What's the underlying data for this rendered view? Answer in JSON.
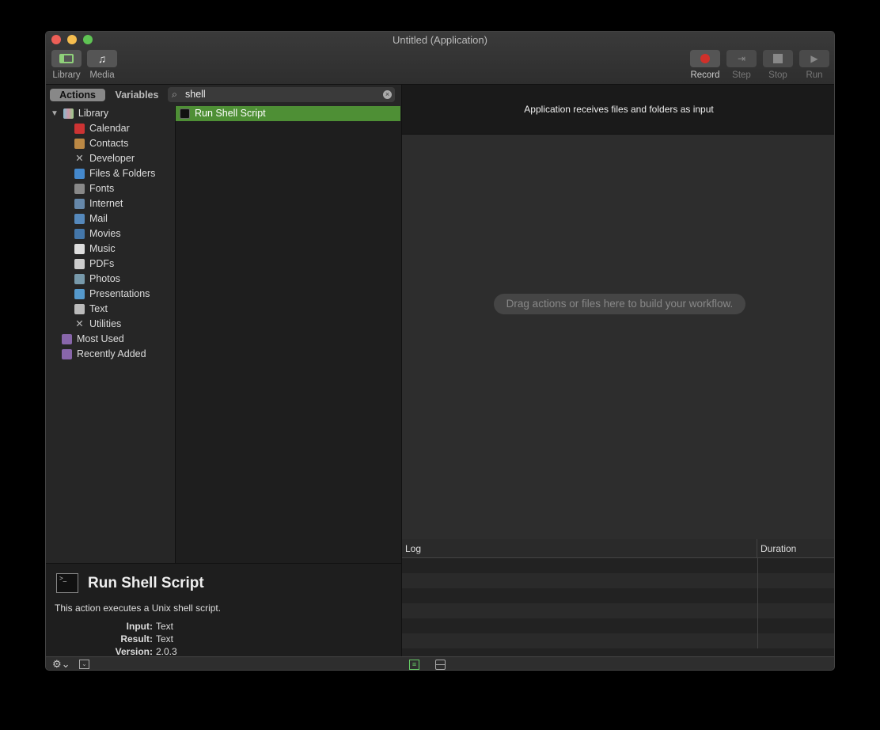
{
  "window": {
    "title": "Untitled (Application)"
  },
  "toolbar": {
    "library": "Library",
    "media": "Media",
    "record": "Record",
    "step": "Step",
    "stop": "Stop",
    "run": "Run",
    "record_color": "#d0302a"
  },
  "tabs": {
    "actions": "Actions",
    "variables": "Variables"
  },
  "search": {
    "value": "shell"
  },
  "sidebar": {
    "root": "Library",
    "items": [
      "Calendar",
      "Contacts",
      "Developer",
      "Files & Folders",
      "Fonts",
      "Internet",
      "Mail",
      "Movies",
      "Music",
      "PDFs",
      "Photos",
      "Presentations",
      "Text",
      "Utilities"
    ],
    "extras": [
      "Most Used",
      "Recently Added"
    ]
  },
  "results": [
    {
      "label": "Run Shell Script",
      "selected_color": "#4e8f35"
    }
  ],
  "description": {
    "title": "Run Shell Script",
    "text": "This action executes a Unix shell script.",
    "input_label": "Input:",
    "input": "Text",
    "result_label": "Result:",
    "result": "Text",
    "version_label": "Version:",
    "version": "2.0.3"
  },
  "workflow": {
    "header": "Application receives files and folders as input",
    "placeholder": "Drag actions or files here to build your workflow."
  },
  "log": {
    "col_log": "Log",
    "col_duration": "Duration"
  }
}
